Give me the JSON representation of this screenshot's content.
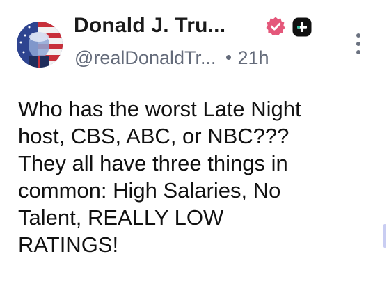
{
  "post": {
    "author_name": "Donald J. Tru...",
    "handle": "@realDonaldTr...",
    "time_ago": "21h",
    "text": "Who has the worst Late Night\nhost, CBS, ABC, or NBC???\nThey all have three things in\ncommon: High Salaries, No\nTalent, REALLY LOW\nRATINGS!"
  },
  "icons": {
    "verified": "verified-badge-icon",
    "plus": "plus-badge-icon",
    "more": "more-vertical-icon"
  },
  "colors": {
    "verified_badge": "#e4577a",
    "plus_badge": "#111111",
    "handle_text": "#646b7a",
    "scrollbar": "#c9cdf2"
  }
}
